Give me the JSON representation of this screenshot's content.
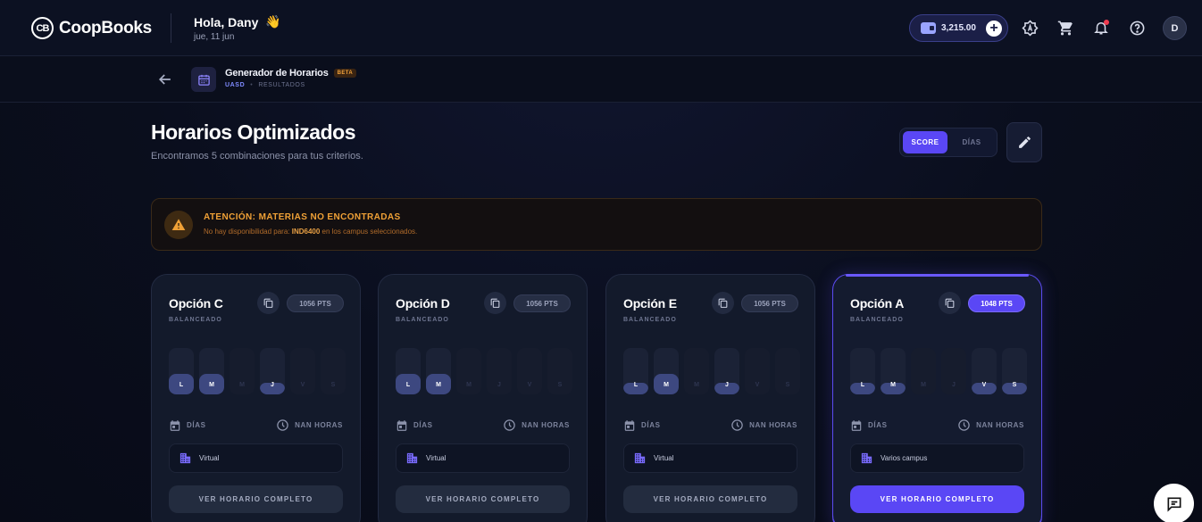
{
  "app": {
    "name": "CoopBooks"
  },
  "header": {
    "greeting": "Hola, Dany",
    "wave_emoji": "👋",
    "date": "jue, 11 jun",
    "wallet_amount": "3,215.00",
    "wallet_add": "+",
    "avatar_initial": "D"
  },
  "subheader": {
    "title": "Generador de Horarios",
    "badge": "BETA",
    "breadcrumb_uni": "UASD",
    "breadcrumb_sep": "•",
    "breadcrumb_page": "RESULTADOS"
  },
  "page": {
    "title": "Horarios Optimizados",
    "subtitle": "Encontramos 5 combinaciones para tus criterios.",
    "sort_options": [
      "SCORE",
      "DÍAS"
    ],
    "sort_selected": "SCORE"
  },
  "warning": {
    "title": "ATENCIÓN: MATERIAS NO ENCONTRADAS",
    "text_prefix": "No hay disponibilidad para: ",
    "course_code": "IND6400",
    "text_suffix": " en los campus seleccionados."
  },
  "cards": [
    {
      "title": "Opción C",
      "tag": "BALANCEADO",
      "points": "1056 PTS",
      "days": [
        {
          "label": "L",
          "fill": 0.45
        },
        {
          "label": "M",
          "fill": 0.45
        },
        {
          "label": "M",
          "fill": 0
        },
        {
          "label": "J",
          "fill": 0.25
        },
        {
          "label": "V",
          "fill": 0
        },
        {
          "label": "S",
          "fill": 0
        }
      ],
      "days_label": "DÍAS",
      "hours_label": "NAN HORAS",
      "campus": "Virtual",
      "cta": "VER HORARIO COMPLETO"
    },
    {
      "title": "Opción D",
      "tag": "BALANCEADO",
      "points": "1056 PTS",
      "days": [
        {
          "label": "L",
          "fill": 0.45
        },
        {
          "label": "M",
          "fill": 0.45
        },
        {
          "label": "M",
          "fill": 0
        },
        {
          "label": "J",
          "fill": 0
        },
        {
          "label": "V",
          "fill": 0
        },
        {
          "label": "S",
          "fill": 0
        }
      ],
      "days_label": "DÍAS",
      "hours_label": "NAN HORAS",
      "campus": "Virtual",
      "cta": "VER HORARIO COMPLETO"
    },
    {
      "title": "Opción E",
      "tag": "BALANCEADO",
      "points": "1056 PTS",
      "days": [
        {
          "label": "L",
          "fill": 0.25
        },
        {
          "label": "M",
          "fill": 0.45
        },
        {
          "label": "M",
          "fill": 0
        },
        {
          "label": "J",
          "fill": 0.25
        },
        {
          "label": "V",
          "fill": 0
        },
        {
          "label": "S",
          "fill": 0
        }
      ],
      "days_label": "DÍAS",
      "hours_label": "NAN HORAS",
      "campus": "Virtual",
      "cta": "VER HORARIO COMPLETO"
    },
    {
      "title": "Opción A",
      "tag": "BALANCEADO",
      "points": "1048 PTS",
      "days": [
        {
          "label": "L",
          "fill": 0.25
        },
        {
          "label": "M",
          "fill": 0.25
        },
        {
          "label": "M",
          "fill": 0
        },
        {
          "label": "J",
          "fill": 0
        },
        {
          "label": "V",
          "fill": 0.25
        },
        {
          "label": "S",
          "fill": 0.25
        }
      ],
      "days_label": "DÍAS",
      "hours_label": "NAN HORAS",
      "campus": "Varios campus",
      "cta": "VER HORARIO COMPLETO",
      "highlighted": true
    }
  ],
  "colors": {
    "accent": "#5a47f5",
    "warning": "#f0a136",
    "background": "#0a0e1d",
    "notification": "#ef3b4f"
  },
  "icons": [
    "logo-icon",
    "wallet-icon",
    "plus-icon",
    "theme-icon",
    "cart-icon",
    "bell-icon",
    "help-icon",
    "back-arrow-icon",
    "calendar-icon",
    "pencil-icon",
    "warning-icon",
    "copy-icon",
    "clock-icon",
    "building-icon",
    "chat-icon"
  ]
}
